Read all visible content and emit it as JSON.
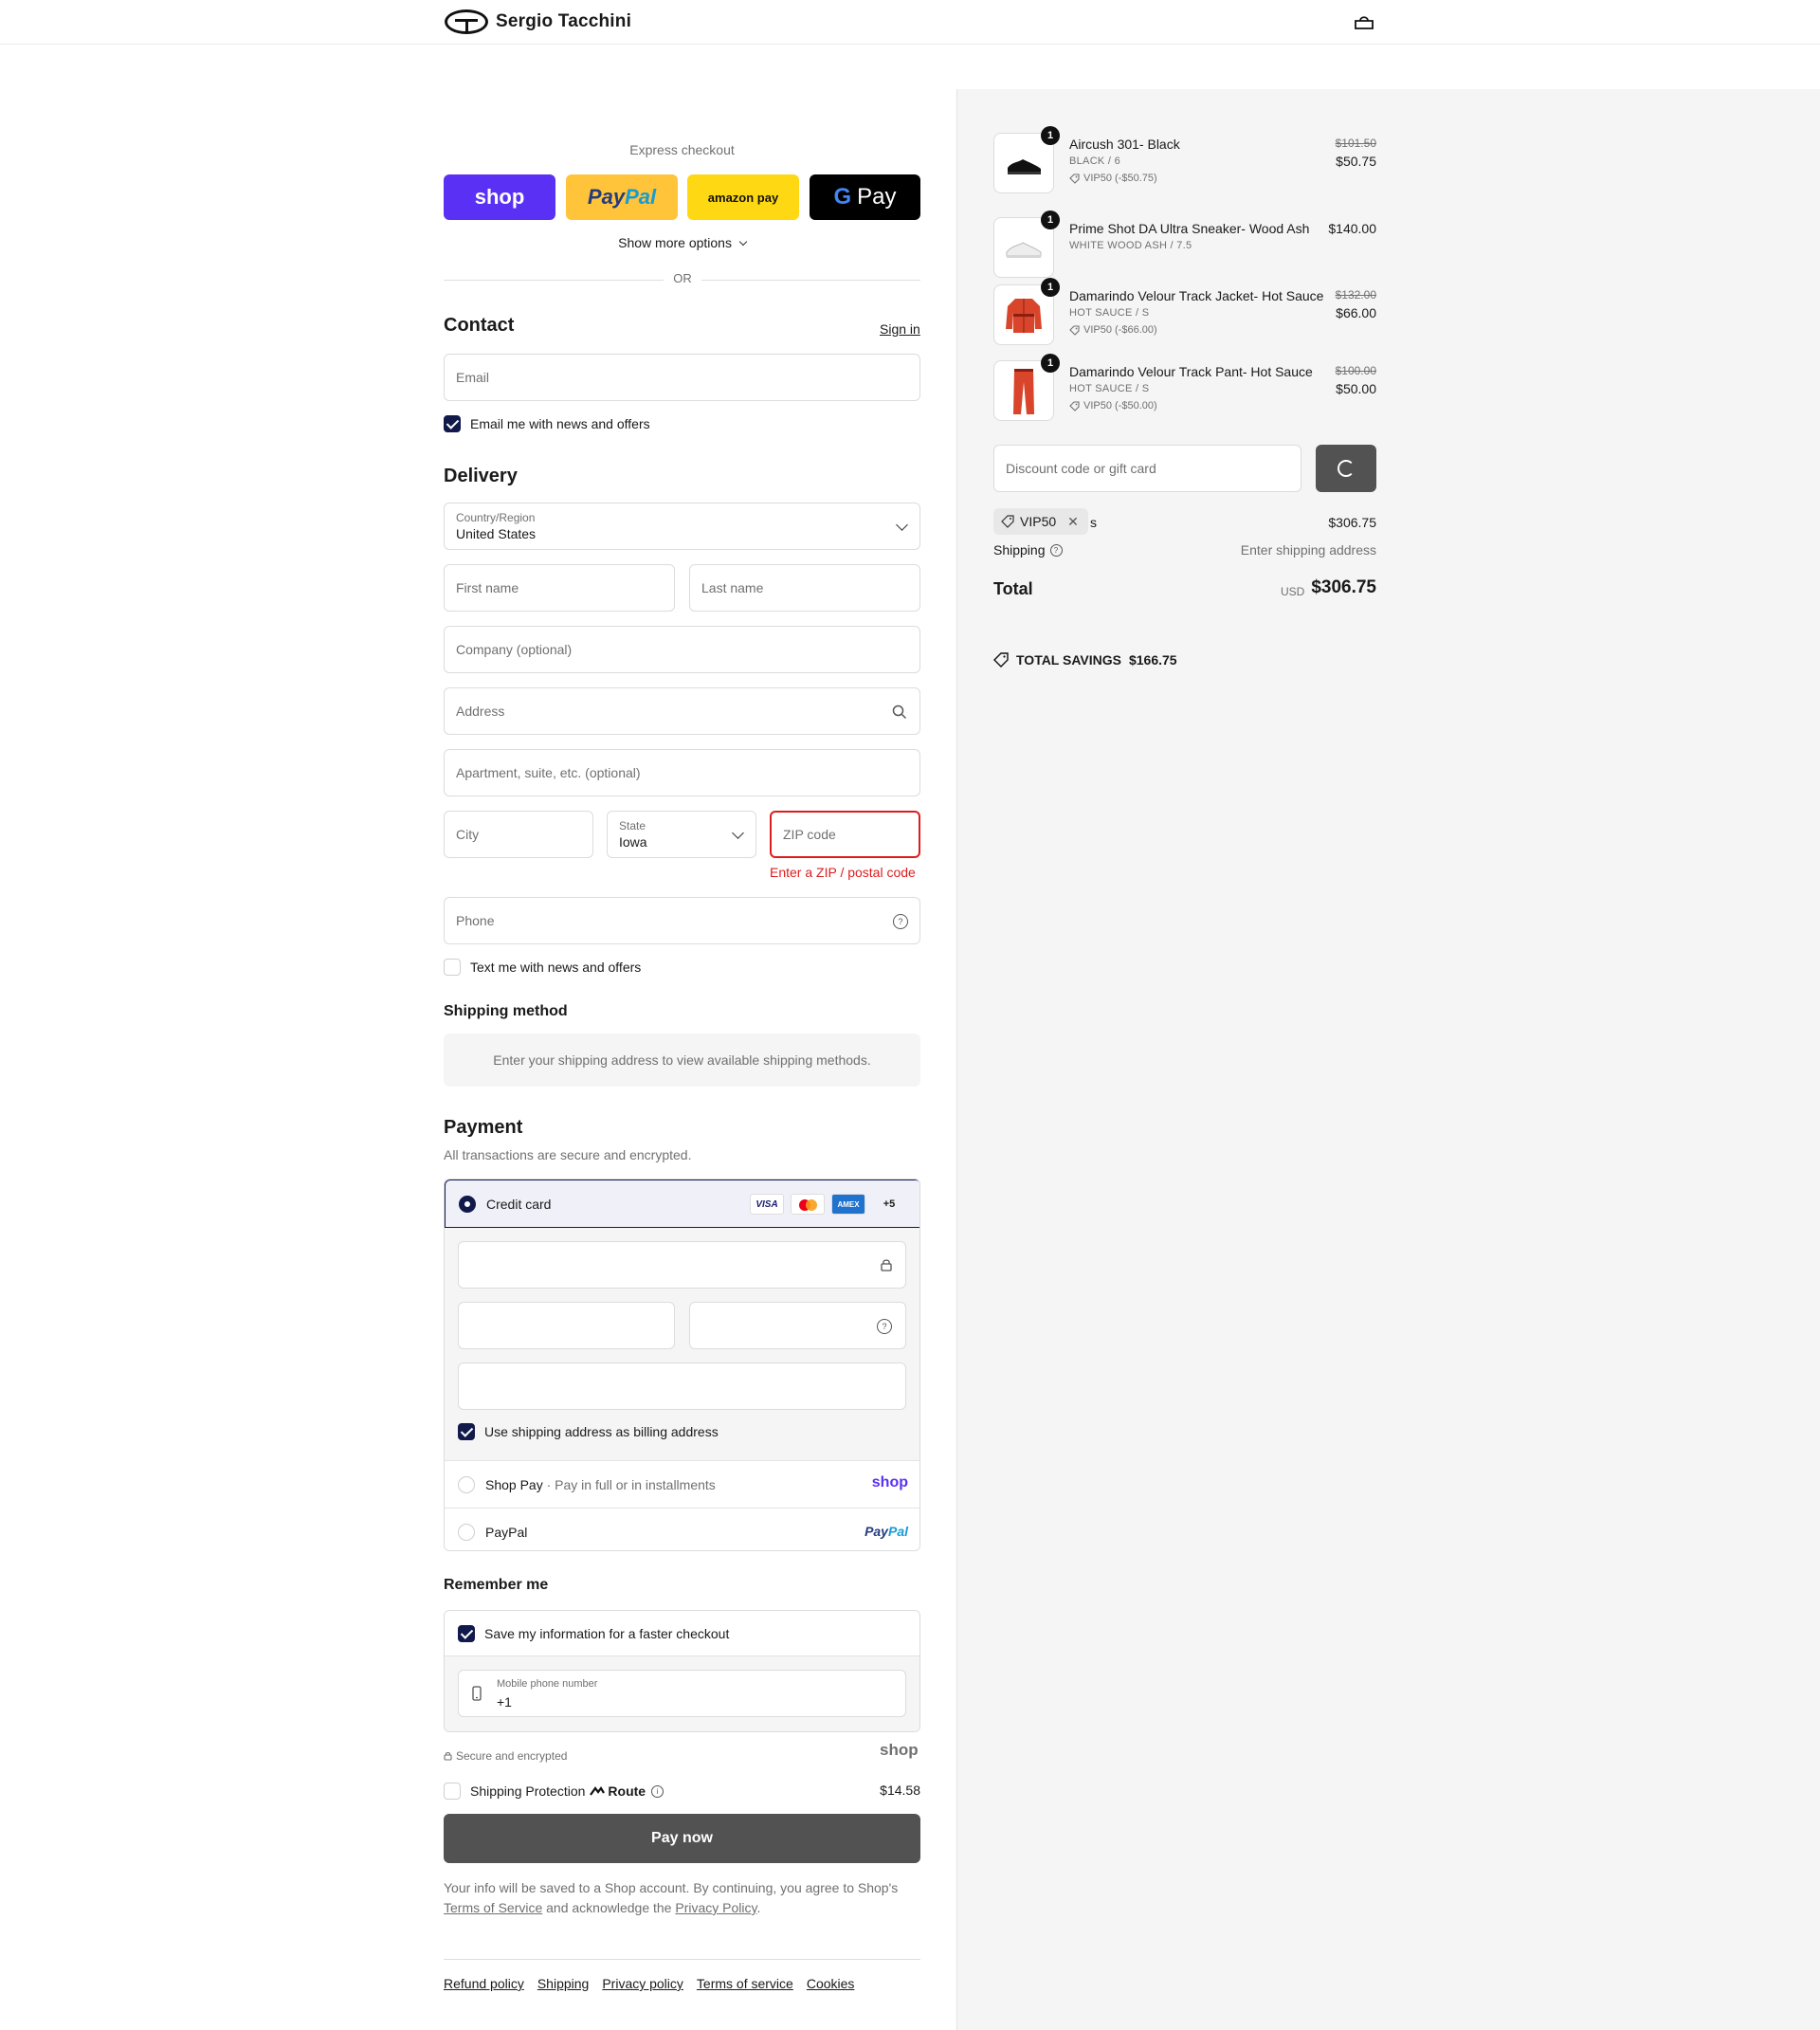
{
  "header": {
    "brand": "Sergio Tacchini"
  },
  "express": {
    "title": "Express checkout",
    "shop_label": "shop",
    "paypal_pay": "Pay",
    "paypal_pal": "Pal",
    "amazon_label": "amazon pay",
    "gpay_g": "G",
    "gpay_label": "Pay",
    "more_options": "Show more options",
    "or": "OR"
  },
  "contact": {
    "title": "Contact",
    "signin": "Sign in",
    "email_placeholder": "Email",
    "news_label": "Email me with news and offers"
  },
  "delivery": {
    "title": "Delivery",
    "country_label": "Country/Region",
    "country_value": "United States",
    "first_name": "First name",
    "last_name": "Last name",
    "company": "Company (optional)",
    "address": "Address",
    "apartment": "Apartment, suite, etc. (optional)",
    "city": "City",
    "state_label": "State",
    "state_value": "Iowa",
    "zip": "ZIP code",
    "zip_error": "Enter a ZIP / postal code",
    "phone": "Phone",
    "text_label": "Text me with news and offers"
  },
  "shipping_method": {
    "title": "Shipping method",
    "message": "Enter your shipping address to view available shipping methods."
  },
  "payment": {
    "title": "Payment",
    "subtitle": "All transactions are secure and encrypted.",
    "credit_card": "Credit card",
    "visa": "VISA",
    "amex": "AMEX",
    "more_cards": "+5",
    "billing_label": "Use shipping address as billing address",
    "shop_pay": "Shop Pay",
    "shop_pay_sub": " · Pay in full or in installments",
    "shop_word": "shop",
    "paypal": "PayPal",
    "paypal_pay": "Pay",
    "paypal_pal": "Pal"
  },
  "remember": {
    "title": "Remember me",
    "save_label": "Save my information for a faster checkout",
    "mobile_label": "Mobile phone number",
    "mobile_value": "+1",
    "secure": "Secure and encrypted",
    "shop_word": "shop"
  },
  "route": {
    "label": "Shipping Protection",
    "brand": "Route",
    "price": "$14.58"
  },
  "pay_now": "Pay now",
  "consent": {
    "text1": "Your info will be saved to a Shop account. By continuing, you agree to Shop's ",
    "terms": "Terms of Service",
    "text2": " and acknowledge the ",
    "privacy": "Privacy Policy",
    "text3": "."
  },
  "footer": {
    "links": [
      "Refund policy",
      "Shipping",
      "Privacy policy",
      "Terms of service",
      "Cookies"
    ]
  },
  "cart": {
    "items": [
      {
        "qty": "1",
        "name": "Aircush 301- Black",
        "variant": "BLACK / 6",
        "discount": "VIP50 (-$50.75)",
        "old_price": "$101.50",
        "price": "$50.75",
        "color": "#111111"
      },
      {
        "qty": "1",
        "name": "Prime Shot DA Ultra Sneaker- Wood Ash",
        "variant": "WHITE WOOD ASH / 7.5",
        "discount": "",
        "old_price": "",
        "price": "$140.00",
        "color": "#e8e8e8"
      },
      {
        "qty": "1",
        "name": "Damarindo Velour Track Jacket- Hot Sauce",
        "variant": "HOT SAUCE / S",
        "discount": "VIP50 (-$66.00)",
        "old_price": "$132.00",
        "price": "$66.00",
        "color": "#d9452a"
      },
      {
        "qty": "1",
        "name": "Damarindo Velour Track Pant- Hot Sauce",
        "variant": "HOT SAUCE / S",
        "discount": "VIP50 (-$50.00)",
        "old_price": "$100.00",
        "price": "$50.00",
        "color": "#d9452a"
      }
    ],
    "discount_placeholder": "Discount code or gift card",
    "applied_code": "VIP50",
    "subtotal_suffix": "s",
    "subtotal": "$306.75",
    "shipping_label": "Shipping",
    "shipping_value": "Enter shipping address",
    "total_label": "Total",
    "currency": "USD",
    "total": "$306.75",
    "savings_label": "TOTAL SAVINGS",
    "savings_value": "$166.75"
  }
}
